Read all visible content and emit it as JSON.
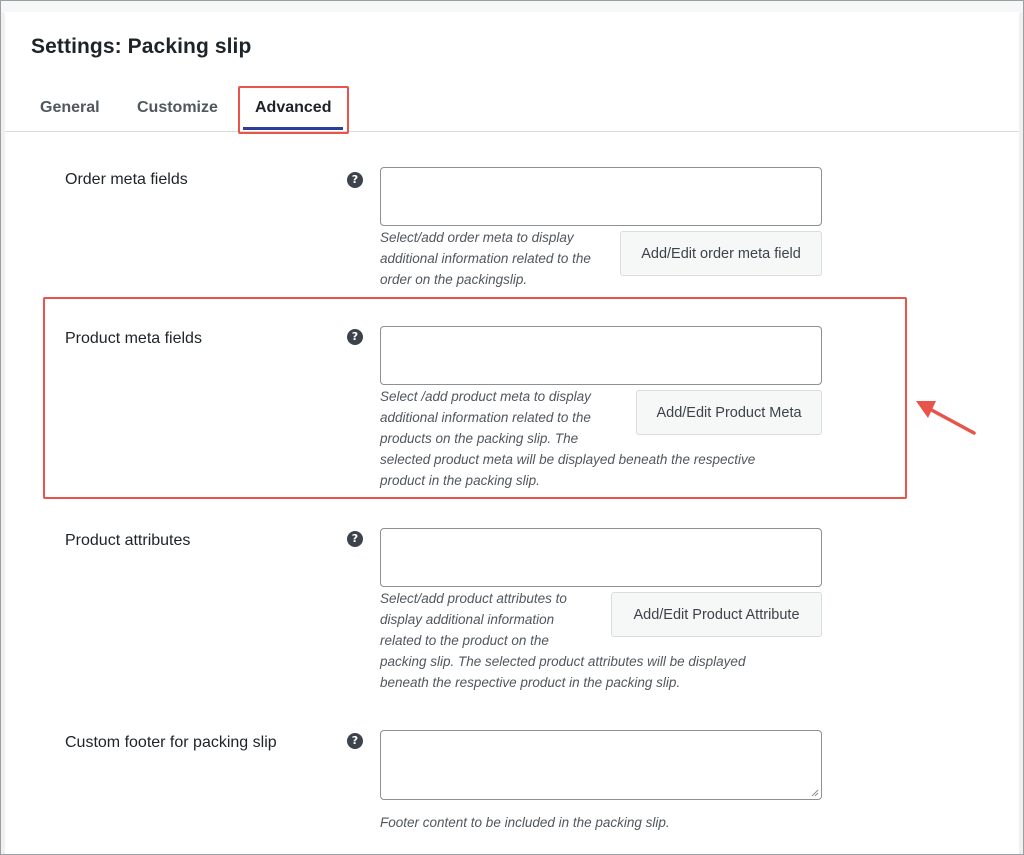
{
  "page": {
    "title": "Settings: Packing slip"
  },
  "tabs": [
    {
      "label": "General",
      "active": false
    },
    {
      "label": "Customize",
      "active": false
    },
    {
      "label": "Advanced",
      "active": true
    }
  ],
  "icons": {
    "help": "?"
  },
  "rows": [
    {
      "label": "Order meta fields",
      "input_value": "",
      "hint_lines": [
        "Select/add order meta to display",
        "additional information related to the",
        "order on the packingslip."
      ],
      "button_label": "Add/Edit order meta field"
    },
    {
      "label": "Product meta fields",
      "input_value": "",
      "hint_lines": [
        "Select /add product meta to display",
        "additional information related to the",
        "products on the packing slip. The",
        "selected product meta will be displayed beneath the respective",
        "product in the packing slip."
      ],
      "button_label": "Add/Edit Product Meta"
    },
    {
      "label": "Product attributes",
      "input_value": "",
      "hint_lines": [
        "Select/add product attributes to",
        "display additional information",
        "related to the product on the",
        "packing slip. The selected product attributes will be displayed",
        "beneath the respective product in the packing slip."
      ],
      "button_label": "Add/Edit Product Attribute"
    },
    {
      "label": "Custom footer for packing slip",
      "input_value": "",
      "hint_lines": [
        "Footer content to be included in the packing slip."
      ]
    }
  ],
  "colors": {
    "highlight": "#e8534a",
    "tab_underline": "#2c3e9a"
  }
}
